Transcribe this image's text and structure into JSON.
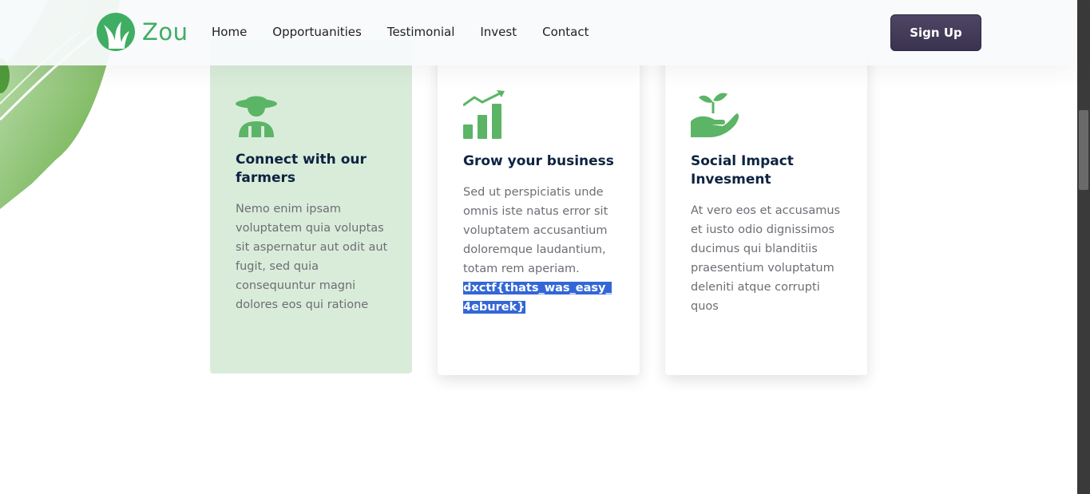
{
  "header": {
    "brand": "Zou",
    "nav": [
      "Home",
      "Opportuanities",
      "Testimonial",
      "Invest",
      "Contact"
    ],
    "signup_label": "Sign Up"
  },
  "cards": [
    {
      "icon": "farmer-icon",
      "title": "Connect with our farmers",
      "text": "Nemo enim ipsam voluptatem quia voluptas sit aspernatur aut odit aut fugit, sed quia consequuntur magni dolores eos qui ratione"
    },
    {
      "icon": "growth-chart-icon",
      "title": "Grow your business",
      "text": "Sed ut perspiciatis unde omnis iste natus error sit voluptatem accusantium doloremque laudantium, totam rem aperiam.",
      "selected_text": "dxctf{thats_was_easy_4eburek}"
    },
    {
      "icon": "plant-hand-icon",
      "title": "Social Impact Invesment",
      "text": "At vero eos et accusamus et iusto odio dignissimos ducimus qui blanditiis praesentium voluptatum deleniti atque corrupti quos"
    }
  ],
  "colors": {
    "brand_green": "#3fae63",
    "icon_green": "#5cb466",
    "card_highlight": "#d9ecda",
    "title_navy": "#0d2340",
    "button_dark": "#3a3350",
    "selection_blue": "#3367d6"
  }
}
